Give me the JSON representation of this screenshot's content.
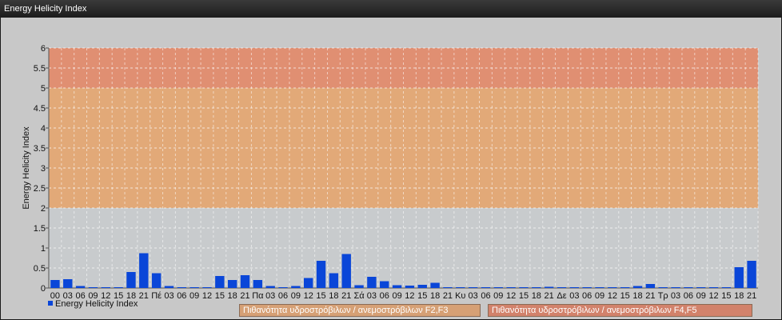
{
  "window": {
    "title": "Energy Helicity Index"
  },
  "colors": {
    "bar": "#0a46d8",
    "band_low": "#c8cbcd",
    "band_mid": "#e2a978",
    "band_high": "#e08f72",
    "grid": "#ffffff"
  },
  "chart_data": {
    "type": "bar",
    "ylabel": "Energy Helicity Index",
    "ylim": [
      0,
      6
    ],
    "yticks": [
      "0",
      "0.5",
      "1",
      "1.5",
      "2",
      "2.5",
      "3",
      "3.5",
      "4",
      "4.5",
      "5",
      "5.5",
      "6"
    ],
    "grid": true,
    "categories": [
      "00",
      "03",
      "06",
      "09",
      "12",
      "15",
      "18",
      "21",
      "Πέ",
      "03",
      "06",
      "09",
      "12",
      "15",
      "18",
      "21",
      "Πα",
      "03",
      "06",
      "09",
      "12",
      "15",
      "18",
      "21",
      "Σά",
      "03",
      "06",
      "09",
      "12",
      "15",
      "18",
      "21",
      "Κυ",
      "03",
      "06",
      "09",
      "12",
      "15",
      "18",
      "21",
      "Δε",
      "03",
      "06",
      "09",
      "12",
      "15",
      "18",
      "21",
      "Τρ",
      "03",
      "06",
      "09",
      "12",
      "15",
      "18",
      "21"
    ],
    "series": [
      {
        "name": "Energy Helicity Index",
        "values": [
          0.2,
          0.22,
          0.05,
          0.02,
          0.02,
          0.02,
          0.4,
          0.87,
          0.37,
          0.05,
          0.02,
          0.02,
          0.02,
          0.3,
          0.2,
          0.32,
          0.2,
          0.05,
          0.02,
          0.05,
          0.25,
          0.68,
          0.37,
          0.85,
          0.07,
          0.28,
          0.17,
          0.07,
          0.06,
          0.08,
          0.13,
          0.02,
          0.02,
          0.02,
          0.02,
          0.02,
          0.02,
          0.02,
          0.02,
          0.03,
          0.02,
          0.02,
          0.02,
          0.02,
          0.02,
          0.02,
          0.05,
          0.1,
          0.02,
          0.02,
          0.02,
          0.02,
          0.02,
          0.02,
          0.52,
          0.68
        ]
      }
    ],
    "bands": [
      {
        "from": 2,
        "to": 5,
        "label": "Πιθανότητα υδροστρόβιλων / ανεμοστρόβιλων F2,F3"
      },
      {
        "from": 5,
        "to": 6,
        "label": "Πιθανότητα υδροστρόβιλων / ανεμοστρόβιλων F4,F5"
      }
    ],
    "legend": "bottom-left"
  }
}
